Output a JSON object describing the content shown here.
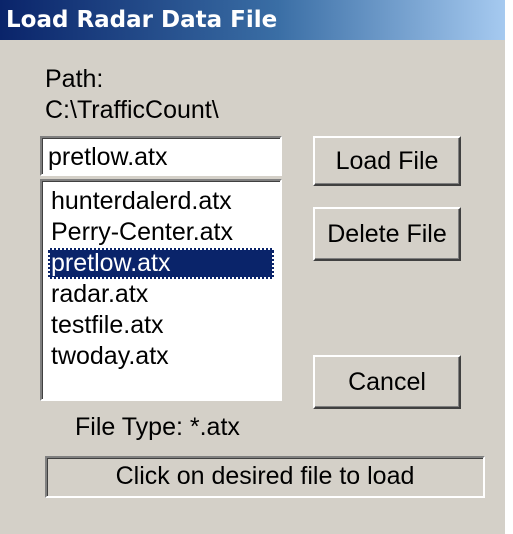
{
  "window": {
    "title": "Load Radar Data File"
  },
  "path": {
    "label": "Path:",
    "value": "C:\\TrafficCount\\"
  },
  "filename_input": {
    "value": "pretlow.atx"
  },
  "file_list": {
    "items": [
      "hunterdalerd.atx",
      "Perry-Center.atx",
      "pretlow.atx",
      "radar.atx",
      "testfile.atx",
      "twoday.atx"
    ],
    "selected_index": 2
  },
  "buttons": {
    "load": "Load File",
    "delete": "Delete File",
    "cancel": "Cancel"
  },
  "file_type": {
    "label": "File Type: *.atx"
  },
  "status": {
    "message": "Click on desired file to load"
  },
  "colors": {
    "titlebar_start": "#0a246a",
    "titlebar_end": "#a6caf0",
    "dialog_face": "#d4d0c8",
    "selection": "#0a246a"
  }
}
